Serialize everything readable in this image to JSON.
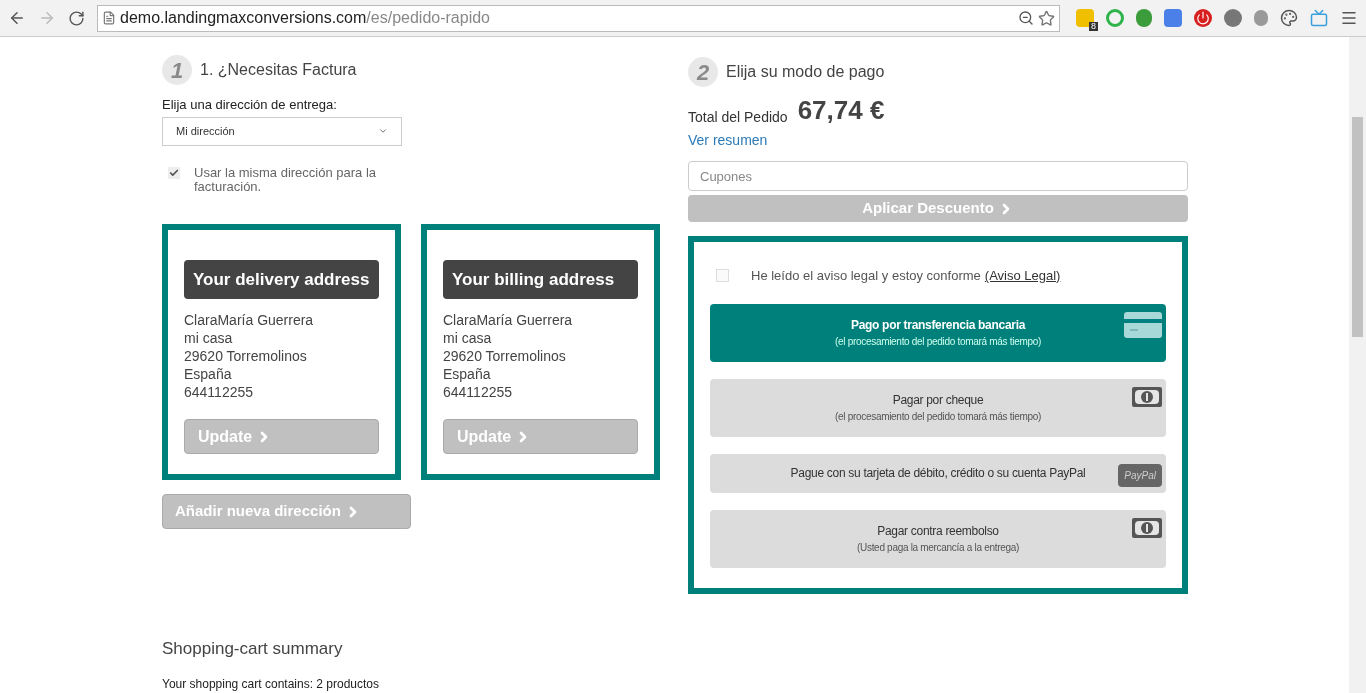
{
  "browser": {
    "url_host": "demo.landingmaxconversions.com",
    "url_path": "/es/pedido-rapido",
    "extension_badge": "8"
  },
  "billing": {
    "step": "1",
    "title": "1. ¿Necesitas Factura",
    "select_label": "Elija una dirección de entrega:",
    "select_value": "Mi dirección",
    "same_address": {
      "label": "Usar la misma dirección para la facturación.",
      "checked": true
    },
    "addresses": [
      {
        "title": "Your delivery address",
        "lines": [
          "ClaraMaría Guerrera",
          "mi casa",
          "29620 Torremolinos",
          "España",
          "644112255"
        ],
        "button": "Update"
      },
      {
        "title": "Your billing address",
        "lines": [
          "ClaraMaría Guerrera",
          "mi casa",
          "29620 Torremolinos",
          "España",
          "644112255"
        ],
        "button": "Update"
      }
    ],
    "add_button": "Añadir nueva dirección"
  },
  "payment": {
    "step": "2",
    "title": "Elija su modo de pago",
    "total_label": "Total del Pedido",
    "total": "67,74 €",
    "summary_link": "Ver resumen",
    "coupon_placeholder": "Cupones",
    "apply_button": "Aplicar Descuento",
    "legal": {
      "text": "He leído el aviso legal y estoy conforme",
      "link": "(Aviso Legal)",
      "checked": false
    },
    "options": [
      {
        "kind": "card",
        "title": "Pago por transferencia bancaria",
        "note": "(el procesamiento del pedido tomará más tiempo)",
        "selected": true
      },
      {
        "kind": "cash",
        "title": "Pagar por cheque",
        "note": "(el procesamiento del pedido tomará más tiempo)",
        "selected": false
      },
      {
        "kind": "paypal",
        "title": "Pague con su tarjeta de débito, crédito o su cuenta PayPal",
        "icon_text": "PayPal",
        "selected": false
      },
      {
        "kind": "cash",
        "title": "Pagar contra reembolso",
        "note": "(Usted paga la mercancía a la entrega)",
        "selected": false
      }
    ]
  },
  "cart": {
    "title": "Shopping-cart summary",
    "text": "Your shopping cart contains: 2 productos"
  }
}
